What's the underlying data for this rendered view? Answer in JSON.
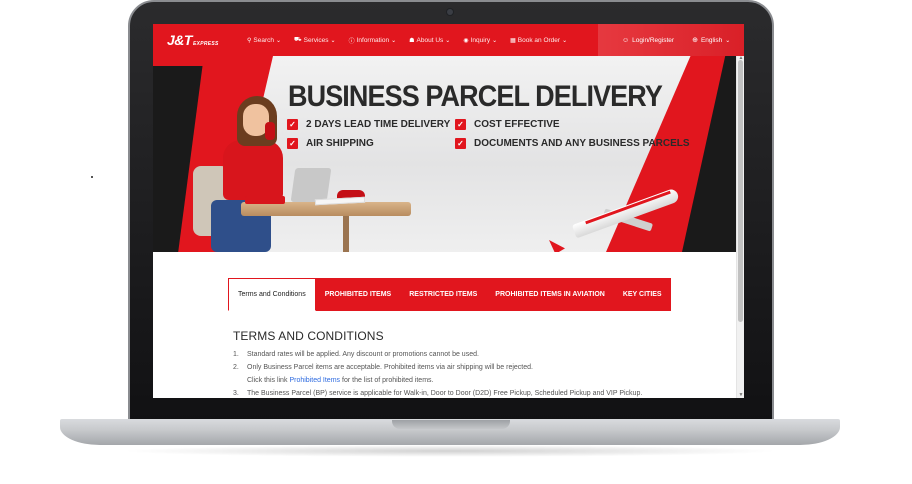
{
  "nav": {
    "logo": "J&T",
    "logo_sub": "EXPRESS",
    "items": [
      {
        "icon": "search-icon",
        "glyph": "⚲",
        "label": "Search"
      },
      {
        "icon": "services-icon",
        "glyph": "⛟",
        "label": "Services"
      },
      {
        "icon": "info-icon",
        "glyph": "ⓘ",
        "label": "Information"
      },
      {
        "icon": "about-icon",
        "glyph": "☗",
        "label": "About Us"
      },
      {
        "icon": "inquiry-icon",
        "glyph": "◉",
        "label": "Inquiry"
      },
      {
        "icon": "book-icon",
        "glyph": "▦",
        "label": "Book an Order"
      }
    ],
    "login": "Login/Register",
    "language": "English"
  },
  "hero": {
    "title": "BUSINESS PARCEL DELIVERY",
    "features": [
      "2 DAYS LEAD TIME DELIVERY",
      "COST EFFECTIVE",
      "AIR SHIPPING",
      "DOCUMENTS AND ANY BUSINESS PARCELS"
    ]
  },
  "tabs": [
    "Terms and Conditions",
    "PROHIBITED ITEMS",
    "RESTRICTED ITEMS",
    "PROHIBITED ITEMS IN AVIATION",
    "KEY CITIES"
  ],
  "content": {
    "title": "TERMS AND CONDITIONS",
    "items": [
      {
        "num": "1.",
        "text": "Standard rates will be applied. Any discount or promotions cannot be used."
      },
      {
        "num": "2.",
        "text": "Only Business Parcel items are acceptable. Prohibited items via air shipping will be rejected."
      },
      {
        "pre": "Click this link",
        "link": "Prohibited Items",
        "post": "for the list of prohibited items."
      },
      {
        "num": "3.",
        "text": "The Business Parcel (BP) service is applicable for Walk-in, Door to Door (D2D) Free Pickup, Scheduled Pickup and VIP Pickup."
      }
    ]
  },
  "colors": {
    "brand_red": "#e1161e",
    "dark": "#1a1a1a",
    "link": "#2e6be0"
  }
}
